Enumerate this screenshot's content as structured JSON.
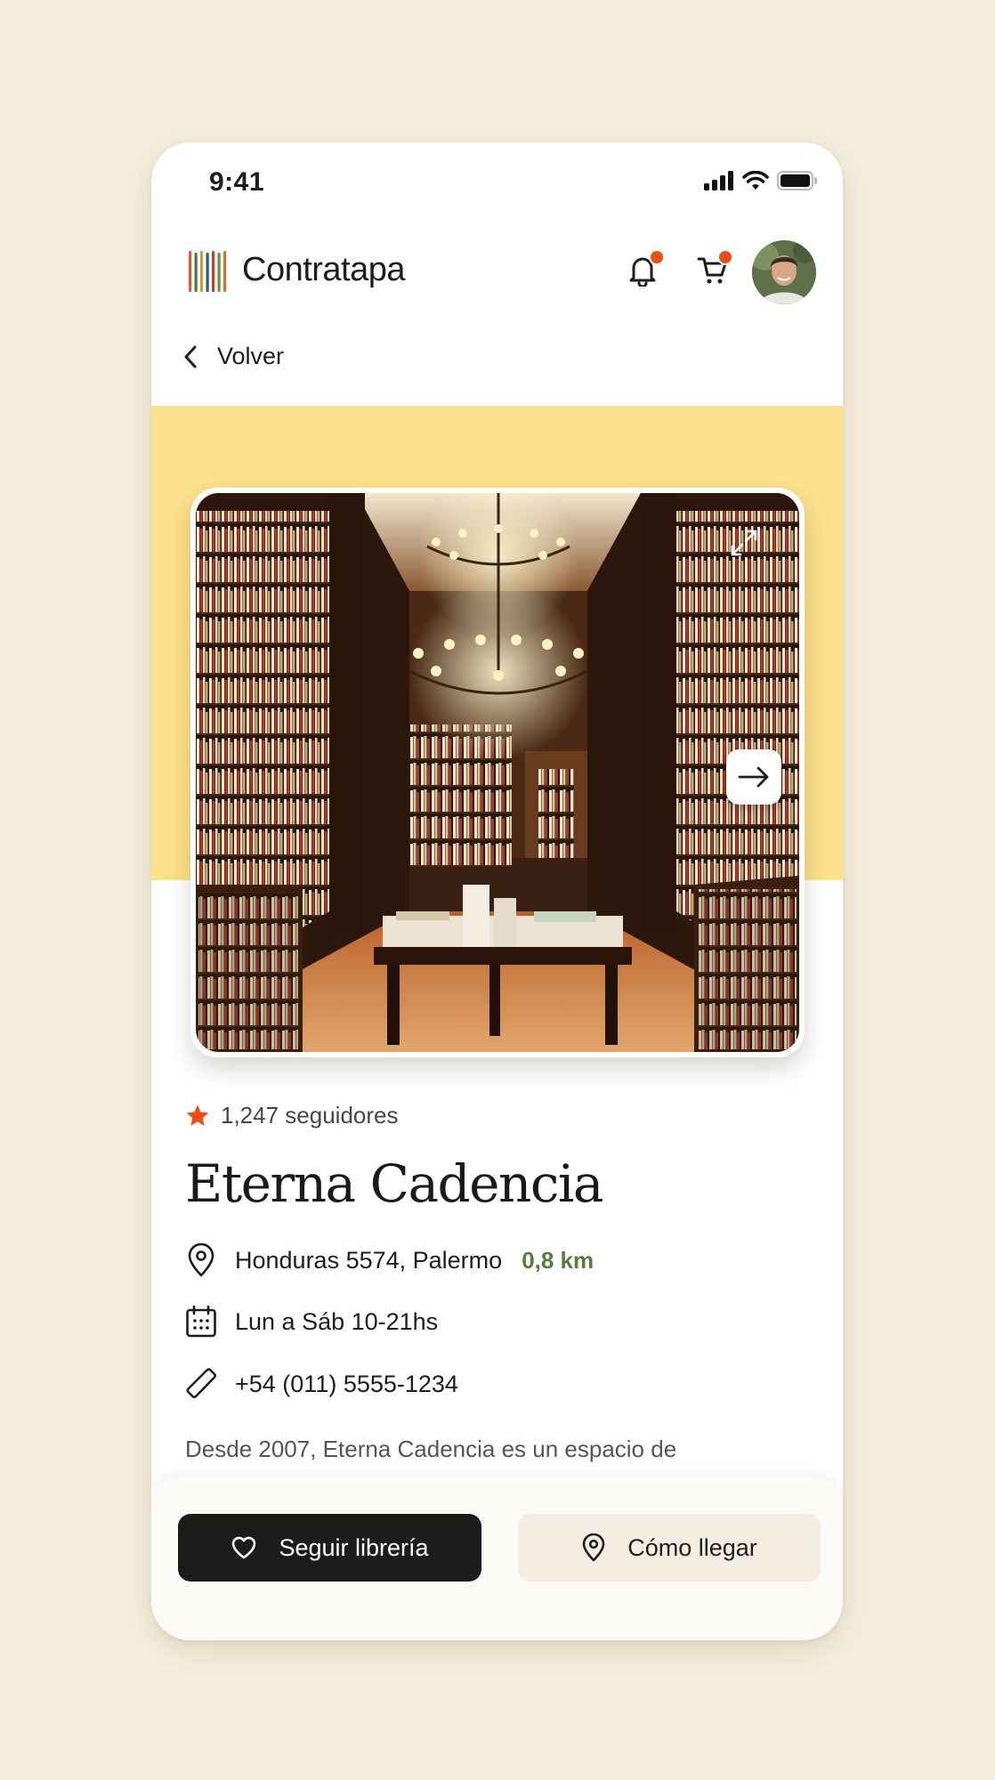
{
  "status_bar": {
    "time": "9:41"
  },
  "header": {
    "brand": "Contratapa",
    "brand_colors": [
      "#e4582a",
      "#3f7a4c",
      "#d99a2b",
      "#2d5b7d",
      "#b6423a",
      "#6b8f3b",
      "#c9762f"
    ],
    "notification_icon": "bell-icon",
    "cart_icon": "cart-icon",
    "badge_color": "#ee4e14"
  },
  "nav": {
    "back_label": "Volver"
  },
  "store": {
    "followers": "1,247 seguidores",
    "name": "Eterna Cadencia",
    "address": "Honduras 5574, Palermo",
    "distance": "0,8 km",
    "hours": "Lun a Sáb 10-21hs",
    "phone": "+54 (011) 5555-1234",
    "description": "Desde 2007, Eterna Cadencia es un espacio de"
  },
  "actions": {
    "follow_label": "Seguir librería",
    "directions_label": "Cómo llegar"
  },
  "colors": {
    "page_bg": "#f5eedc",
    "hero_band": "#fce28a",
    "accent_orange": "#ee4e14",
    "distance_green": "#5a7a3e",
    "primary_button": "#1e1c1a",
    "secondary_button": "#f4eee2"
  }
}
